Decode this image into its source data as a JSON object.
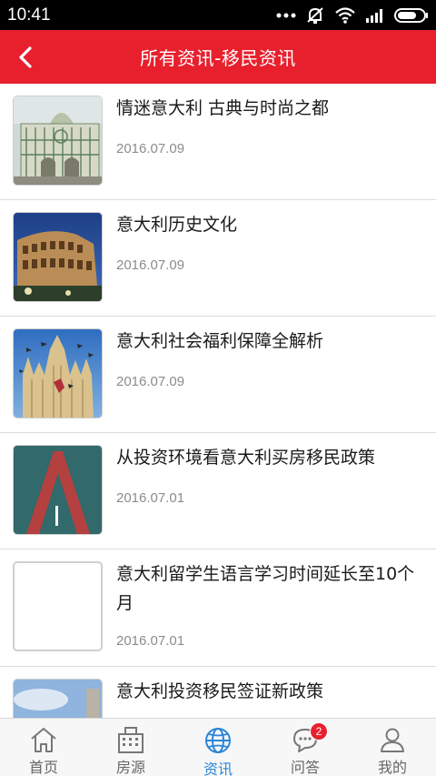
{
  "status_bar": {
    "time": "10:41"
  },
  "header": {
    "title": "所有资讯-移民资讯"
  },
  "news": [
    {
      "title": "情迷意大利 古典与时尚之都",
      "date": "2016.07.09",
      "thumb": "florence-cathedral"
    },
    {
      "title": "意大利历史文化",
      "date": "2016.07.09",
      "thumb": "colosseum"
    },
    {
      "title": "意大利社会福利保障全解析",
      "date": "2016.07.09",
      "thumb": "milan-cathedral"
    },
    {
      "title": "从投资环境看意大利买房移民政策",
      "date": "2016.07.01",
      "thumb": "red-a-logo"
    },
    {
      "title": "意大利留学生语言学习时间延长至10个月",
      "date": "2016.07.01",
      "thumb": "blank"
    },
    {
      "title": "意大利投资移民签证新政策",
      "date": "",
      "thumb": "sky-tower"
    }
  ],
  "nav": {
    "items": [
      {
        "label": "首页",
        "icon": "home-icon"
      },
      {
        "label": "房源",
        "icon": "building-icon"
      },
      {
        "label": "资讯",
        "icon": "globe-icon"
      },
      {
        "label": "问答",
        "icon": "chat-icon",
        "badge": "2"
      },
      {
        "label": "我的",
        "icon": "user-icon"
      }
    ],
    "active": "资讯",
    "active_color": "#2b86d8"
  },
  "colors": {
    "header": "#e8202d",
    "badge": "#e8202d"
  }
}
